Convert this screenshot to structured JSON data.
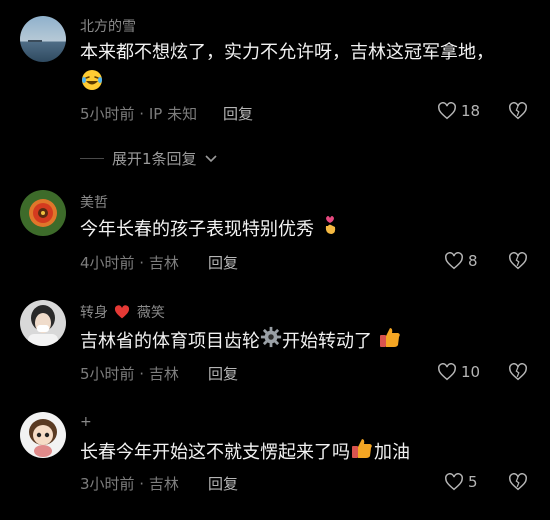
{
  "comments": [
    {
      "username": "北方的雪",
      "text": "本来都不想炫了，实力不允许呀，吉林这冠军拿地，",
      "meta": "5小时前 · IP 未知",
      "reply": "回复",
      "likes": "18",
      "emoji": "laughing-tears-emoji"
    },
    {
      "username": "美哲",
      "text": "今年长春的孩子表现特别优秀",
      "meta": "4小时前 · 吉林",
      "reply": "回复",
      "likes": "8",
      "emoji": "finger-heart-emoji"
    },
    {
      "username_part1": "转身",
      "username_part2": "薇笑",
      "text_part1": "吉林省的体育项目齿轮",
      "text_part2": "开始转动了",
      "meta": "5小时前 · 吉林",
      "reply": "回复",
      "likes": "10",
      "emoji": "thumbs-up-emoji"
    },
    {
      "username": "+",
      "text_part1": "长春今年开始这不就支愣起来了吗",
      "text_part2": "加油",
      "meta": "3小时前 · 吉林",
      "reply": "回复",
      "likes": "5",
      "emoji": "thumbs-up-emoji"
    }
  ],
  "expand_replies": "展开1条回复",
  "colors": {
    "background": "#000000",
    "text": "#f2f2f2",
    "muted": "#8a8a8a",
    "red_heart": "#e53935",
    "thumb": "#f5a623"
  }
}
